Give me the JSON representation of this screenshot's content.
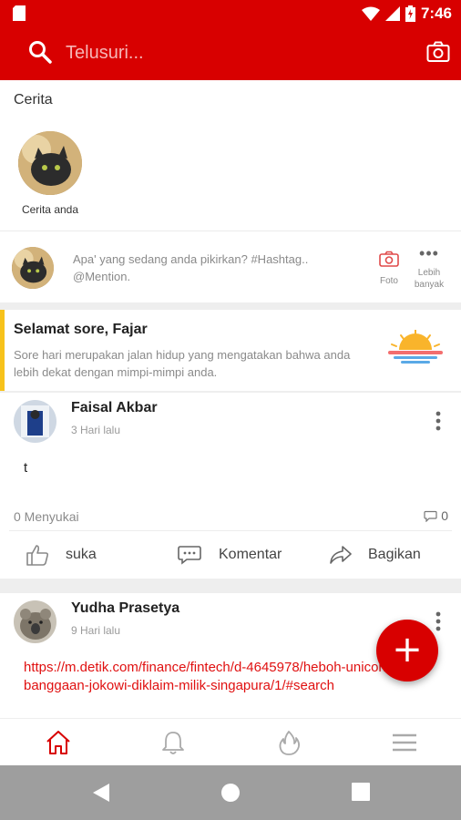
{
  "status_bar": {
    "time": "7:46"
  },
  "search": {
    "placeholder": "Telusuri..."
  },
  "stories": {
    "title": "Cerita",
    "items": [
      {
        "label": "Cerita anda"
      }
    ]
  },
  "composer": {
    "prompt": "Apa' yang sedang anda pikirkan? #Hashtag.. @Mention.",
    "photo_label": "Foto",
    "more_label": "Lebih banyak"
  },
  "greeting": {
    "title": "Selamat sore, Fajar",
    "text": "Sore hari merupakan jalan hidup yang mengatakan bahwa anda lebih dekat dengan mimpi-mimpi anda."
  },
  "posts": [
    {
      "author": "Faisal Akbar",
      "time": "3 Hari lalu",
      "content": "t",
      "likes": "0 Menyukai",
      "comments": "0",
      "actions": {
        "like": "suka",
        "comment": "Komentar",
        "share": "Bagikan"
      }
    },
    {
      "author": "Yudha Prasetya",
      "time": "9 Hari lalu",
      "link": "https://m.detik.com/finance/fintech/d-4645978/heboh-unicorn-kebanggaan-jokowi-diklaim-milik-singapura/1/#search"
    }
  ],
  "colors": {
    "brand": "#d80000",
    "greeting_accent": "#f7c21b",
    "link": "#e01010"
  },
  "icons": {
    "fab": "plus-icon",
    "nav": [
      "home-icon",
      "bell-icon",
      "fire-icon",
      "menu-icon"
    ],
    "active_tab": "home-icon"
  }
}
